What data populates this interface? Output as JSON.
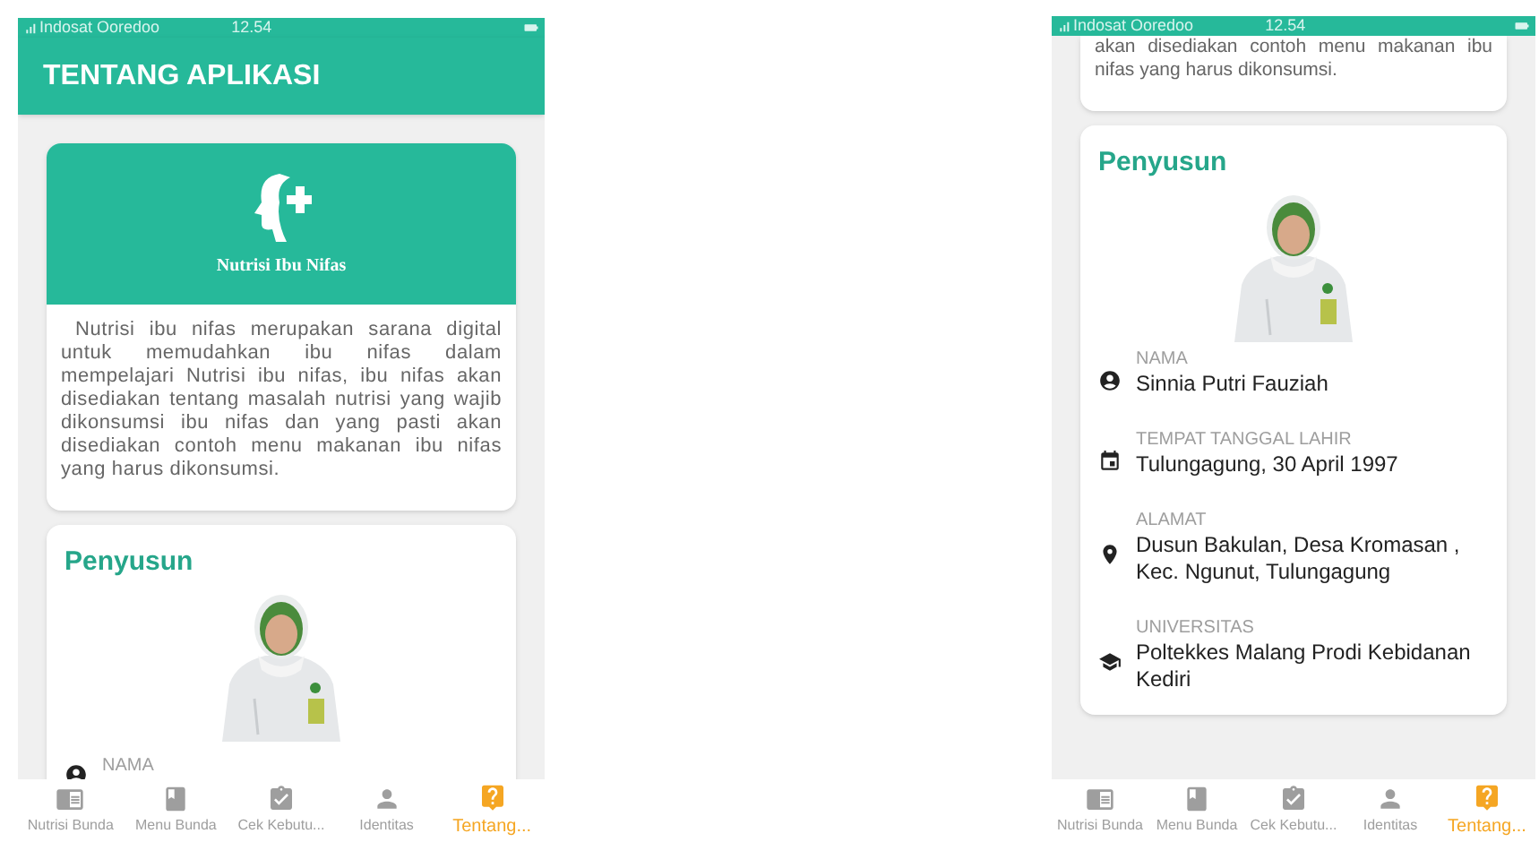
{
  "screens": [
    {
      "status_bar": {
        "carrier": "Indosat Ooredoo",
        "time": "12.54"
      },
      "header": {
        "title": "TENTANG APLIKASI"
      },
      "app_card": {
        "logo_title": "Nutrisi Ibu Nifas",
        "description": "Nutrisi ibu nifas merupakan sarana digital untuk memudahkan ibu nifas dalam mempelajari Nutrisi ibu nifas, ibu nifas akan disediakan tentang masalah nutrisi yang wajib dikonsumsi ibu nifas dan yang pasti akan disediakan contoh menu makanan ibu nifas yang harus dikonsumsi."
      },
      "author_card": {
        "title": "Penyusun",
        "fields": [
          {
            "kind": "person",
            "label": "NAMA"
          }
        ]
      },
      "tab_bar": [
        {
          "kind": "reader",
          "label": "Nutrisi Bunda",
          "selected": false
        },
        {
          "kind": "book",
          "label": "Menu Bunda",
          "selected": false
        },
        {
          "kind": "check",
          "label": "Cek Kebutu...",
          "selected": false
        },
        {
          "kind": "person",
          "label": "Identitas",
          "selected": false
        },
        {
          "kind": "help",
          "label": "Tentang...",
          "selected": true
        }
      ]
    },
    {
      "status_bar": {
        "carrier": "Indosat Ooredoo",
        "time": "12.54"
      },
      "app_card": {
        "description": "akan disediakan contoh menu makanan ibu nifas yang harus dikonsumsi."
      },
      "author_card": {
        "title": "Penyusun",
        "fields": [
          {
            "kind": "person",
            "label": "NAMA",
            "value": "Sinnia Putri Fauziah"
          },
          {
            "kind": "date",
            "label": "TEMPAT TANGGAL LAHIR",
            "value": "Tulungagung, 30 April 1997"
          },
          {
            "kind": "place",
            "label": "ALAMAT",
            "value": "Dusun Bakulan, Desa Kromasan , Kec. Ngunut, Tulungagung"
          },
          {
            "kind": "school",
            "label": "UNIVERSITAS",
            "value": "Poltekkes Malang Prodi Kebidanan Kediri"
          }
        ]
      },
      "tab_bar": [
        {
          "kind": "reader",
          "label": "Nutrisi Bunda",
          "selected": false
        },
        {
          "kind": "book",
          "label": "Menu Bunda",
          "selected": false
        },
        {
          "kind": "check",
          "label": "Cek Kebutu...",
          "selected": false
        },
        {
          "kind": "person",
          "label": "Identitas",
          "selected": false
        },
        {
          "kind": "help",
          "label": "Tentang...",
          "selected": true
        }
      ]
    }
  ]
}
